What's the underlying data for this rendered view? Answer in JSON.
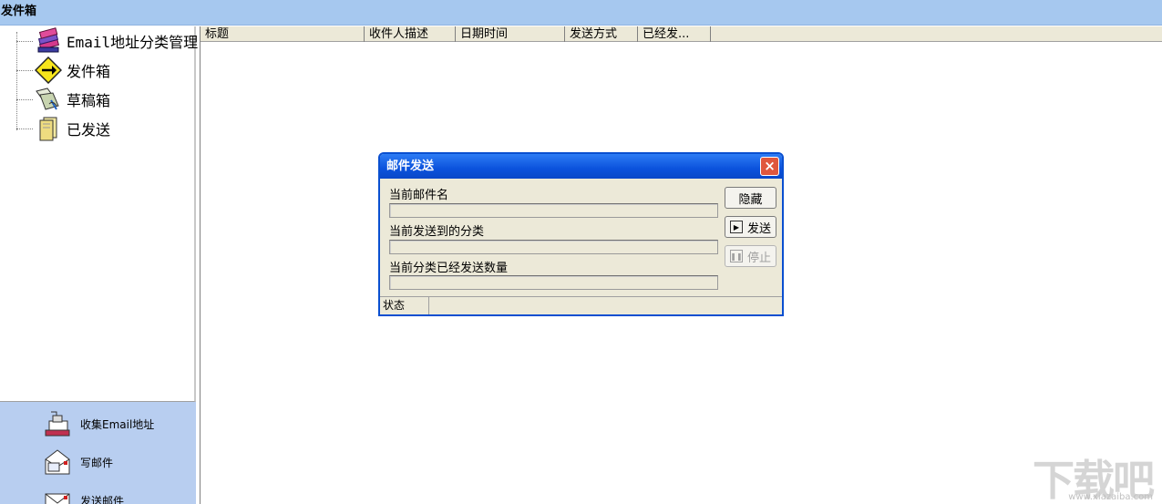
{
  "window": {
    "title": "发件箱"
  },
  "tree": {
    "items": [
      {
        "label": "Email地址分类管理",
        "icon": "address-book-icon"
      },
      {
        "label": "发件箱",
        "icon": "outbox-arrow-icon"
      },
      {
        "label": "草稿箱",
        "icon": "drafts-icon"
      },
      {
        "label": "已发送",
        "icon": "sent-folder-icon"
      }
    ]
  },
  "sidebar": {
    "buttons": [
      {
        "label": "收集Email地址",
        "icon": "collect-email-icon"
      },
      {
        "label": "写邮件",
        "icon": "compose-mail-icon"
      },
      {
        "label": "发送邮件",
        "icon": "send-mail-icon"
      }
    ]
  },
  "list": {
    "columns": [
      "标题",
      "收件人描述",
      "日期时间",
      "发送方式",
      "已经发..."
    ]
  },
  "dialog": {
    "title": "邮件发送",
    "close": "×",
    "current_mail_label": "当前邮件名",
    "current_mail_value": "",
    "current_category_label": "当前发送到的分类",
    "current_category_value": "",
    "sent_count_label": "当前分类已经发送数量",
    "sent_count_value": "",
    "hide_button": "隐藏",
    "send_button": "发送",
    "stop_button": "停止",
    "status_label": "状态",
    "status_value": ""
  },
  "watermark": {
    "text": "下载吧",
    "url": "www.xiazaiba.com"
  },
  "colors": {
    "title_bar": "#a6c8ef",
    "sidebar_bottom": "#b8cef0",
    "dialog_title": "#0b52dc",
    "dialog_bg": "#ece9d8"
  }
}
